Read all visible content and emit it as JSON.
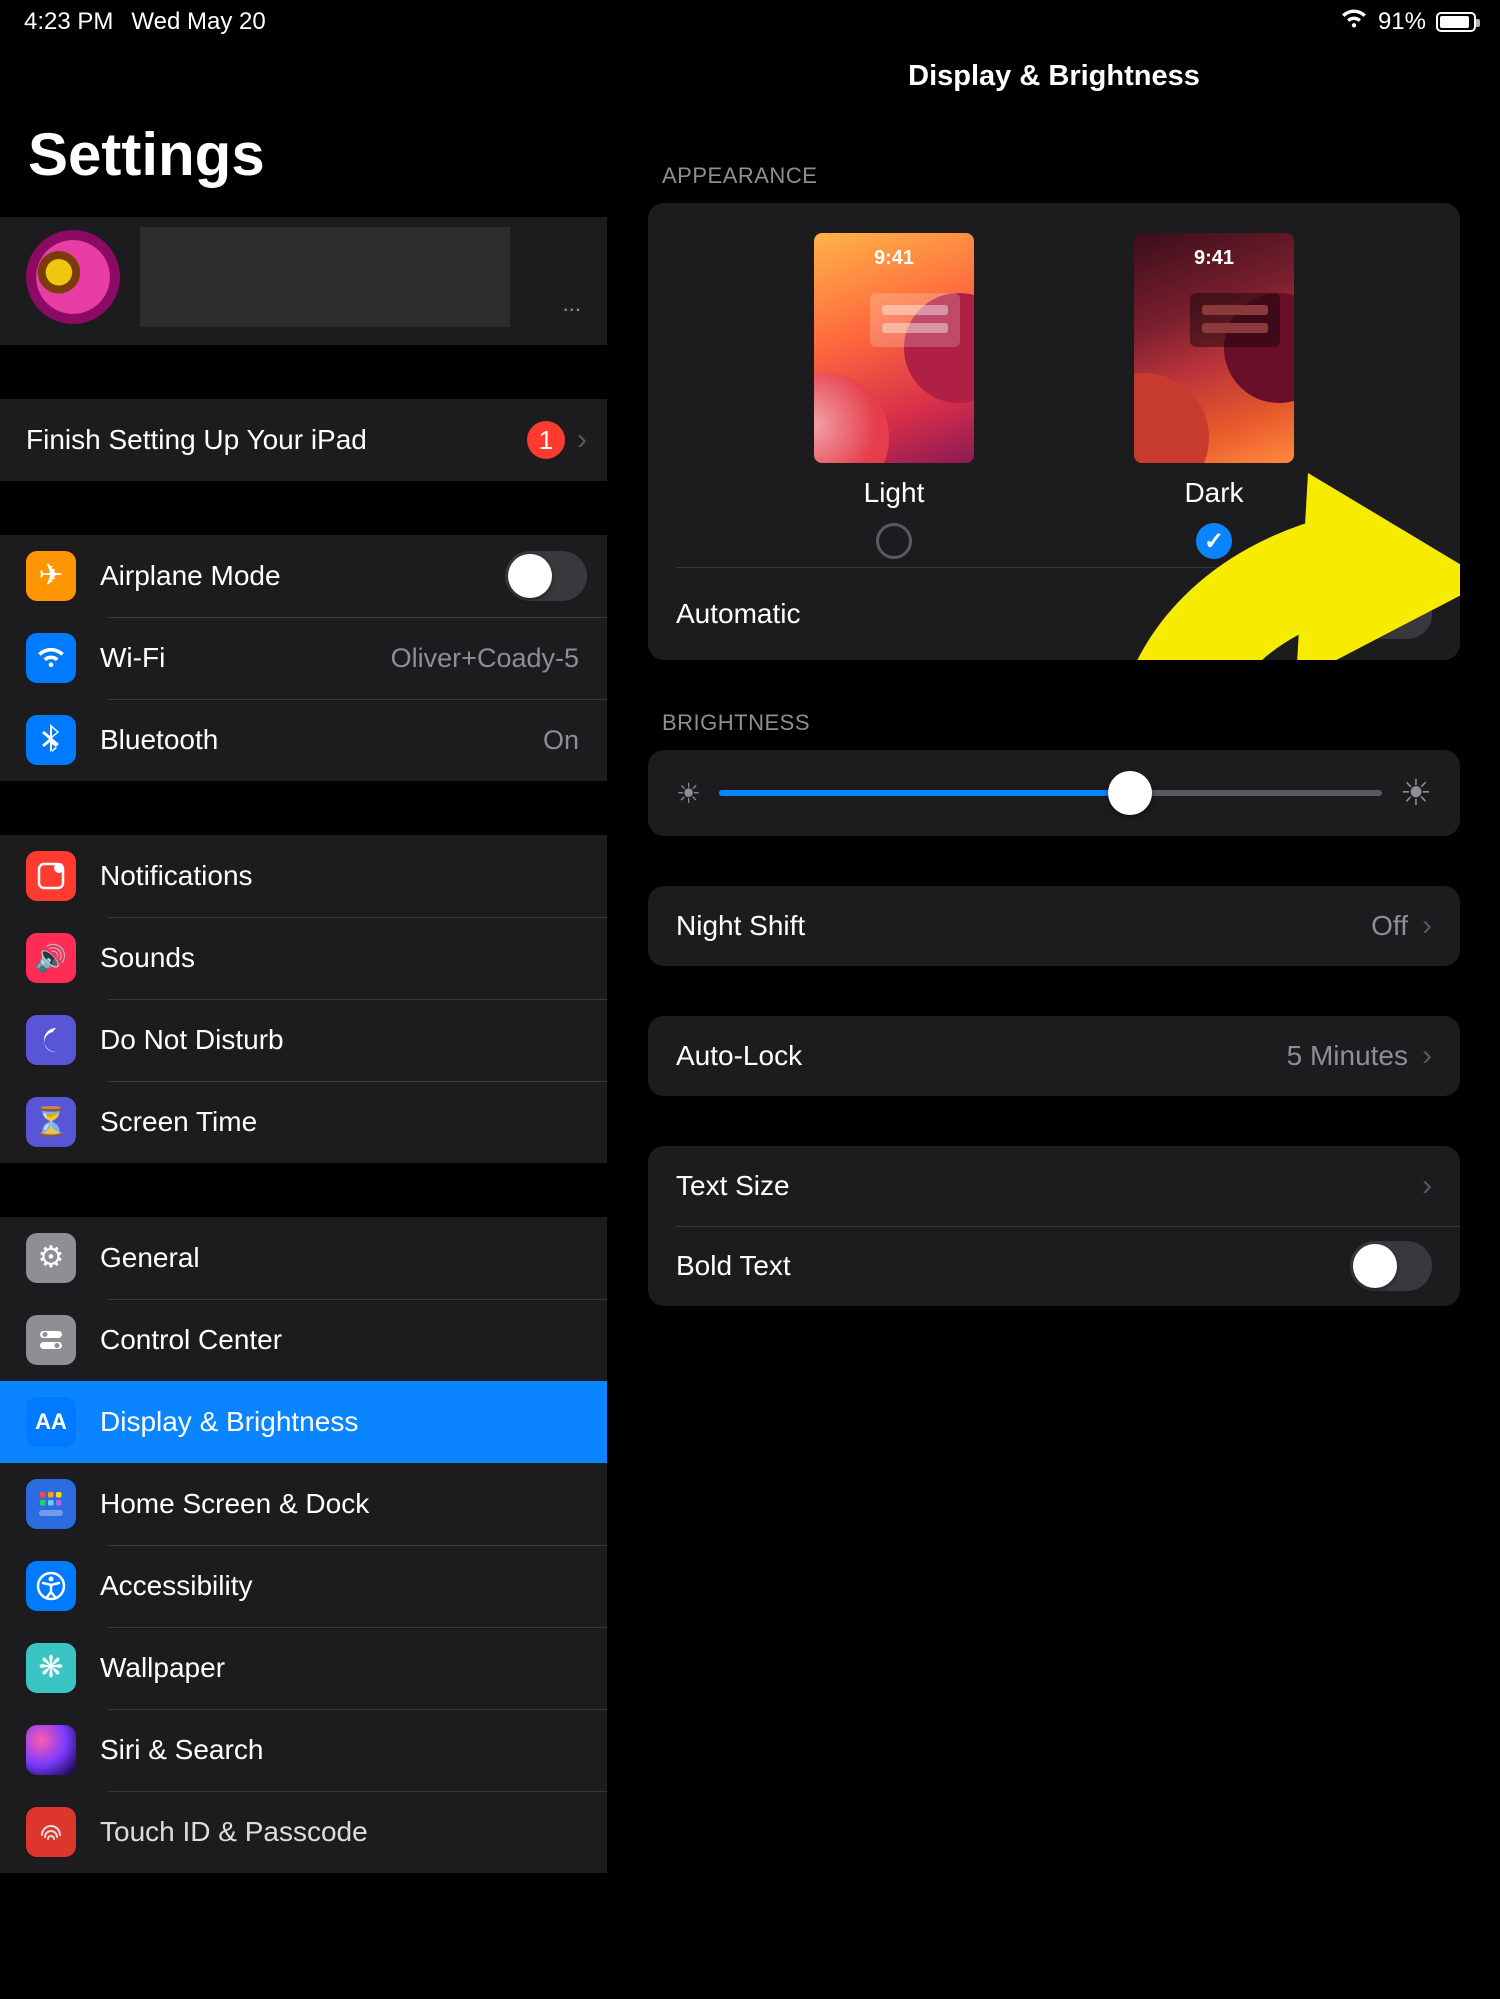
{
  "status": {
    "time": "4:23 PM",
    "date": "Wed May 20",
    "battery_pct": "91%",
    "battery_fill_pct": 91
  },
  "sidebar": {
    "title": "Settings",
    "profile_more": "...",
    "finish_setup": {
      "label": "Finish Setting Up Your iPad",
      "badge": "1"
    },
    "net": {
      "airplane": "Airplane Mode",
      "wifi": "Wi-Fi",
      "wifi_value": "Oliver+Coady-5",
      "bluetooth": "Bluetooth",
      "bluetooth_value": "On"
    },
    "alerts": {
      "notifications": "Notifications",
      "sounds": "Sounds",
      "dnd": "Do Not Disturb",
      "screentime": "Screen Time"
    },
    "main": {
      "general": "General",
      "control_center": "Control Center",
      "display": "Display & Brightness",
      "home_dock": "Home Screen & Dock",
      "accessibility": "Accessibility",
      "wallpaper": "Wallpaper",
      "siri": "Siri & Search",
      "touchid": "Touch ID & Passcode"
    }
  },
  "detail": {
    "title": "Display & Brightness",
    "appearance_header": "APPEARANCE",
    "light_label": "Light",
    "dark_label": "Dark",
    "tile_time": "9:41",
    "automatic": "Automatic",
    "brightness_header": "BRIGHTNESS",
    "brightness_pct": 62,
    "night_shift": "Night Shift",
    "night_shift_value": "Off",
    "auto_lock": "Auto-Lock",
    "auto_lock_value": "5 Minutes",
    "text_size": "Text Size",
    "bold_text": "Bold Text"
  }
}
